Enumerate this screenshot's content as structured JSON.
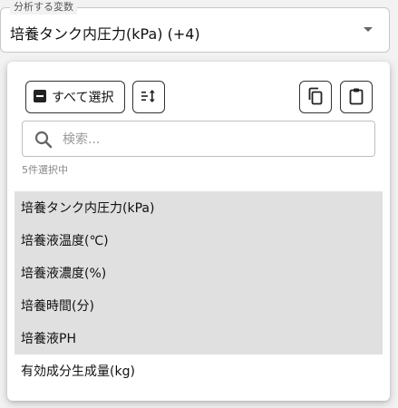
{
  "field": {
    "legend": "分析する変数",
    "value": "培養タンク内圧力(kPa) (+4)"
  },
  "toolbar": {
    "select_all_label": "すべて選択"
  },
  "search": {
    "placeholder": "検索..."
  },
  "status": {
    "selected_count": "5件選択中"
  },
  "list": {
    "items": [
      {
        "label": "培養タンク内圧力(kPa)",
        "selected": true
      },
      {
        "label": "培養液温度(℃)",
        "selected": true
      },
      {
        "label": "培養液濃度(%)",
        "selected": true
      },
      {
        "label": "培養時間(分)",
        "selected": true
      },
      {
        "label": "培養液PH",
        "selected": true
      },
      {
        "label": "有効成分生成量(kg)",
        "selected": false
      }
    ]
  },
  "icons": {
    "deselect": "minus-square-icon",
    "sort": "sort-icon",
    "copy": "copy-icon",
    "paste": "clipboard-icon",
    "search": "search-icon",
    "caret": "caret-down-icon"
  },
  "colors": {
    "selected_row": "#e0e0e0",
    "border": "#333333"
  }
}
